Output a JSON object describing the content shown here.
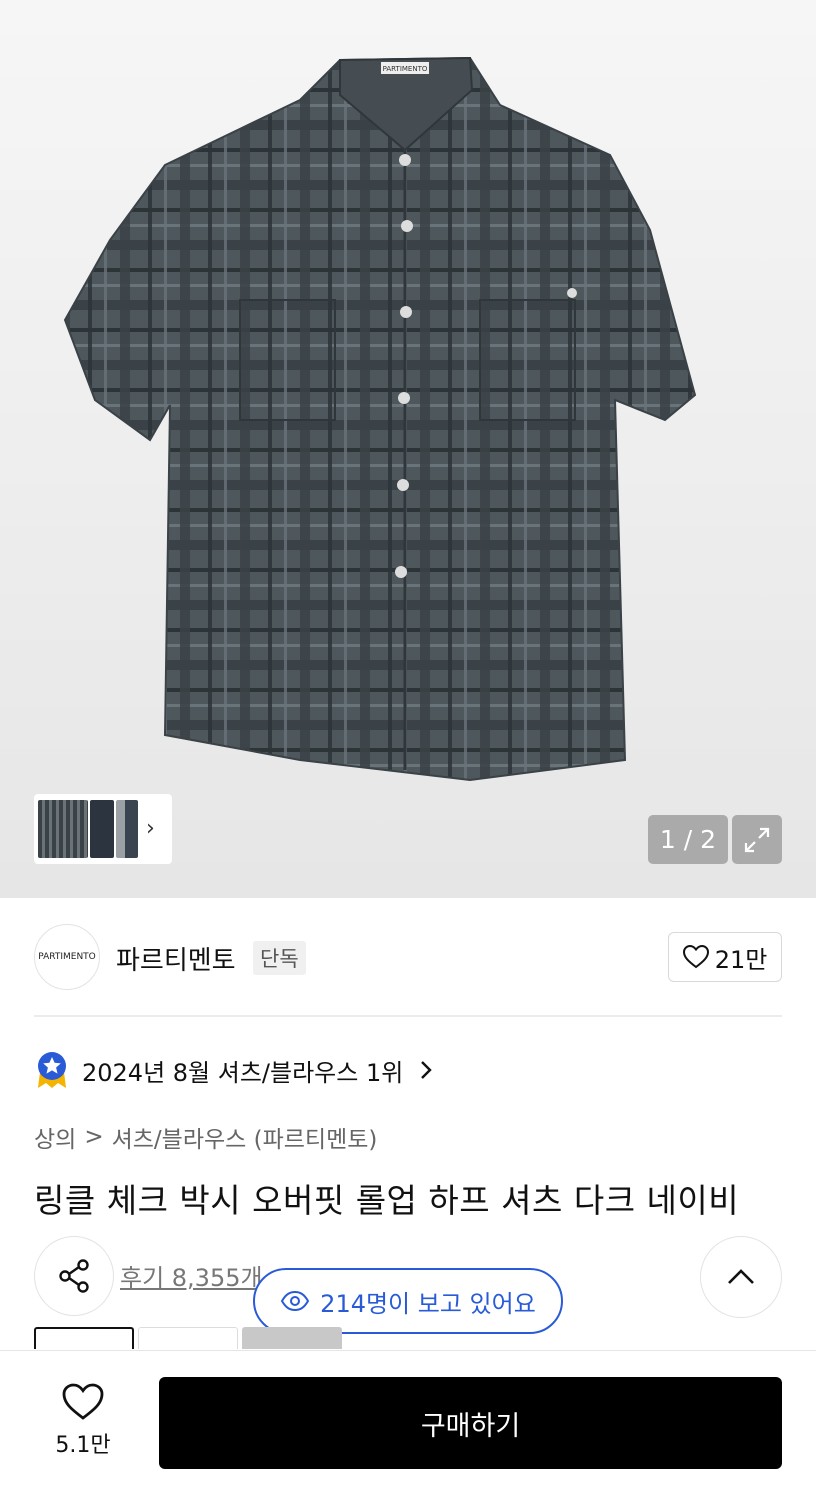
{
  "gallery": {
    "brand_tag": "PARTIMENTO",
    "pager": "1 / 2",
    "thumb_arrow": "›",
    "icons": {
      "expand": "expand-icon",
      "chevron": "chevron-right-icon"
    }
  },
  "brand": {
    "logo_text": "PARTIMENTO",
    "name": "파르티멘토",
    "badge": "단독",
    "like_count": "21만"
  },
  "ranking": {
    "text": "2024년 8월 셔츠/블라우스 1위",
    "icon": "rank-badge-icon"
  },
  "breadcrumb": {
    "level1": "상의",
    "separator": ">",
    "level2": "셔츠/블라우스 (파르티멘토)"
  },
  "product": {
    "title": "링클 체크 박시 오버핏 롤업 하프 셔츠 다크 네이비",
    "review": "후기 8,355개",
    "viewers": "214명이 보고 있어요"
  },
  "bottom": {
    "wish_count": "5.1만",
    "buy_label": "구매하기"
  },
  "colors": {
    "accent_blue": "#2a5bd7",
    "buy_bg": "#000000",
    "shirt": "#4b5459"
  }
}
